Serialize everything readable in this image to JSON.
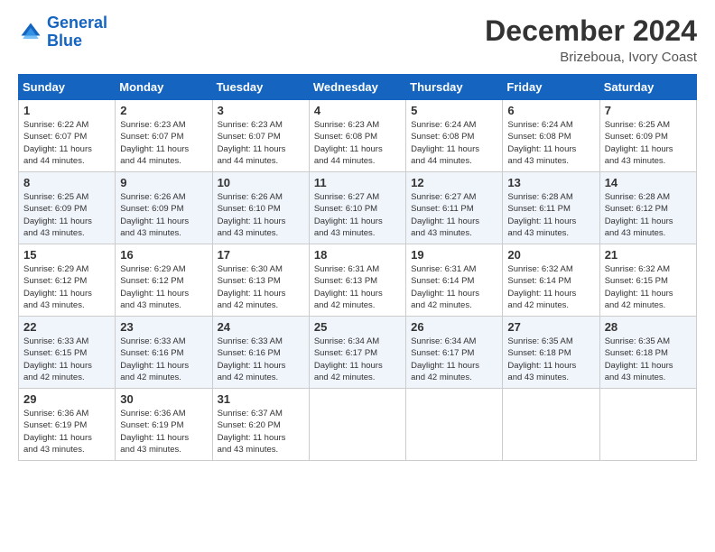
{
  "logo": {
    "line1": "General",
    "line2": "Blue"
  },
  "title": "December 2024",
  "subtitle": "Brizeboua, Ivory Coast",
  "days_header": [
    "Sunday",
    "Monday",
    "Tuesday",
    "Wednesday",
    "Thursday",
    "Friday",
    "Saturday"
  ],
  "weeks": [
    [
      {
        "day": "1",
        "info": "Sunrise: 6:22 AM\nSunset: 6:07 PM\nDaylight: 11 hours\nand 44 minutes."
      },
      {
        "day": "2",
        "info": "Sunrise: 6:23 AM\nSunset: 6:07 PM\nDaylight: 11 hours\nand 44 minutes."
      },
      {
        "day": "3",
        "info": "Sunrise: 6:23 AM\nSunset: 6:07 PM\nDaylight: 11 hours\nand 44 minutes."
      },
      {
        "day": "4",
        "info": "Sunrise: 6:23 AM\nSunset: 6:08 PM\nDaylight: 11 hours\nand 44 minutes."
      },
      {
        "day": "5",
        "info": "Sunrise: 6:24 AM\nSunset: 6:08 PM\nDaylight: 11 hours\nand 44 minutes."
      },
      {
        "day": "6",
        "info": "Sunrise: 6:24 AM\nSunset: 6:08 PM\nDaylight: 11 hours\nand 43 minutes."
      },
      {
        "day": "7",
        "info": "Sunrise: 6:25 AM\nSunset: 6:09 PM\nDaylight: 11 hours\nand 43 minutes."
      }
    ],
    [
      {
        "day": "8",
        "info": "Sunrise: 6:25 AM\nSunset: 6:09 PM\nDaylight: 11 hours\nand 43 minutes."
      },
      {
        "day": "9",
        "info": "Sunrise: 6:26 AM\nSunset: 6:09 PM\nDaylight: 11 hours\nand 43 minutes."
      },
      {
        "day": "10",
        "info": "Sunrise: 6:26 AM\nSunset: 6:10 PM\nDaylight: 11 hours\nand 43 minutes."
      },
      {
        "day": "11",
        "info": "Sunrise: 6:27 AM\nSunset: 6:10 PM\nDaylight: 11 hours\nand 43 minutes."
      },
      {
        "day": "12",
        "info": "Sunrise: 6:27 AM\nSunset: 6:11 PM\nDaylight: 11 hours\nand 43 minutes."
      },
      {
        "day": "13",
        "info": "Sunrise: 6:28 AM\nSunset: 6:11 PM\nDaylight: 11 hours\nand 43 minutes."
      },
      {
        "day": "14",
        "info": "Sunrise: 6:28 AM\nSunset: 6:12 PM\nDaylight: 11 hours\nand 43 minutes."
      }
    ],
    [
      {
        "day": "15",
        "info": "Sunrise: 6:29 AM\nSunset: 6:12 PM\nDaylight: 11 hours\nand 43 minutes."
      },
      {
        "day": "16",
        "info": "Sunrise: 6:29 AM\nSunset: 6:12 PM\nDaylight: 11 hours\nand 43 minutes."
      },
      {
        "day": "17",
        "info": "Sunrise: 6:30 AM\nSunset: 6:13 PM\nDaylight: 11 hours\nand 42 minutes."
      },
      {
        "day": "18",
        "info": "Sunrise: 6:31 AM\nSunset: 6:13 PM\nDaylight: 11 hours\nand 42 minutes."
      },
      {
        "day": "19",
        "info": "Sunrise: 6:31 AM\nSunset: 6:14 PM\nDaylight: 11 hours\nand 42 minutes."
      },
      {
        "day": "20",
        "info": "Sunrise: 6:32 AM\nSunset: 6:14 PM\nDaylight: 11 hours\nand 42 minutes."
      },
      {
        "day": "21",
        "info": "Sunrise: 6:32 AM\nSunset: 6:15 PM\nDaylight: 11 hours\nand 42 minutes."
      }
    ],
    [
      {
        "day": "22",
        "info": "Sunrise: 6:33 AM\nSunset: 6:15 PM\nDaylight: 11 hours\nand 42 minutes."
      },
      {
        "day": "23",
        "info": "Sunrise: 6:33 AM\nSunset: 6:16 PM\nDaylight: 11 hours\nand 42 minutes."
      },
      {
        "day": "24",
        "info": "Sunrise: 6:33 AM\nSunset: 6:16 PM\nDaylight: 11 hours\nand 42 minutes."
      },
      {
        "day": "25",
        "info": "Sunrise: 6:34 AM\nSunset: 6:17 PM\nDaylight: 11 hours\nand 42 minutes."
      },
      {
        "day": "26",
        "info": "Sunrise: 6:34 AM\nSunset: 6:17 PM\nDaylight: 11 hours\nand 42 minutes."
      },
      {
        "day": "27",
        "info": "Sunrise: 6:35 AM\nSunset: 6:18 PM\nDaylight: 11 hours\nand 43 minutes."
      },
      {
        "day": "28",
        "info": "Sunrise: 6:35 AM\nSunset: 6:18 PM\nDaylight: 11 hours\nand 43 minutes."
      }
    ],
    [
      {
        "day": "29",
        "info": "Sunrise: 6:36 AM\nSunset: 6:19 PM\nDaylight: 11 hours\nand 43 minutes."
      },
      {
        "day": "30",
        "info": "Sunrise: 6:36 AM\nSunset: 6:19 PM\nDaylight: 11 hours\nand 43 minutes."
      },
      {
        "day": "31",
        "info": "Sunrise: 6:37 AM\nSunset: 6:20 PM\nDaylight: 11 hours\nand 43 minutes."
      },
      null,
      null,
      null,
      null
    ]
  ]
}
